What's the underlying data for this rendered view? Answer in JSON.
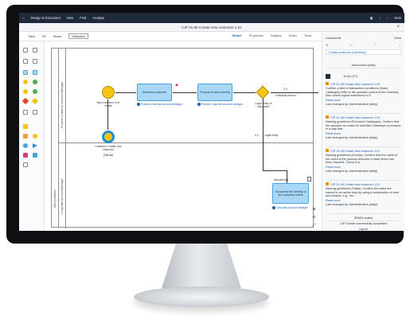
{
  "app_bar": {
    "items": [
      "Design & Document",
      "New",
      "Find",
      "Analyse"
    ],
    "right_user": "Hein"
  },
  "window": {
    "title": "CIP 01.08 Create new customer 1.51"
  },
  "toolbar": {
    "items": [
      "New",
      "Fit",
      "Share"
    ],
    "selected": "Validation"
  },
  "tabs": [
    {
      "label": "Model",
      "active": true
    },
    {
      "label": "Properties",
      "active": false
    },
    {
      "label": "Insights",
      "active": false
    },
    {
      "label": "Notes",
      "active": false
    },
    {
      "label": "Tools",
      "active": false
    }
  ],
  "diagram": {
    "lanes": [
      "Process Customer Account Manager",
      "Corporate Account Manager"
    ],
    "pool_label": "Administration",
    "start_event_label": "New customer is to create",
    "task1": "Interview customer",
    "task1_role": "Process Customer Account Manager",
    "task2": "Process Ensure identity",
    "task2_role": "Process Customer Account Manager",
    "gateway_label": "Legal entity or individual?",
    "flow_label_1": "Individual person",
    "flow_label_2": "Legal entity",
    "end_event_label": "Customer Create new customer",
    "end_event_sub": "[Official]",
    "task3": "Document the identity of the customer online",
    "task3_header": "Manual task",
    "task3_role": "Corporate Account Manager",
    "num_a": "2.0",
    "num_b": "2.2"
  },
  "right_panel": {
    "dropdown": "Unresolved",
    "clear": "Clear",
    "chip": "Create customer (Interview)",
    "section_1": "Announced policy",
    "todo_label": "To do (2/7)",
    "cards": [
      {
        "title": "CIP 01.08 Create new customer 1.51",
        "body": "Confirm a field of transaction conditions (Sales Catalogue) refer to the question posed at the Gateway. Also check logical extensions to it.",
        "link": "Read more",
        "meta": "Last changed by: Administration (daily)"
      },
      {
        "title": "CIP 01.08 Create new customer 1.51",
        "body": "Naming guidelines (Exclusive Catalogue). Confirm that the question as exists for activities Gateways is phrased in a way that",
        "link": "Read more",
        "meta": "Last changed by: Administration (daily)"
      },
      {
        "title": "CIP 01.08 Create new customer 1.51",
        "body": "Naming guidelines (Events). Confirm that the name of the event is the process describe a state which has been reached. Check it in",
        "link": "Read more",
        "meta": "Last changed by: Administration (daily)"
      },
      {
        "title": "CIP 01.08 Create new customer 1.51",
        "body": "Naming guidelines (Tasks). Confirm the tasks are named in an active way by using a combination of verb and subject, e.g. 'Inv...",
        "link": "Read more",
        "meta": "Last changed by: Administration (daily)"
      }
    ],
    "section_2": "SPARs smiles",
    "status": "CIP Create successfully completed",
    "section_3": "Layout"
  },
  "colors": {
    "appbar": "#1e2a3a",
    "task_fill": "#a9d7f6",
    "event_fill": "#f5c518",
    "accent": "#1a5fb4"
  }
}
